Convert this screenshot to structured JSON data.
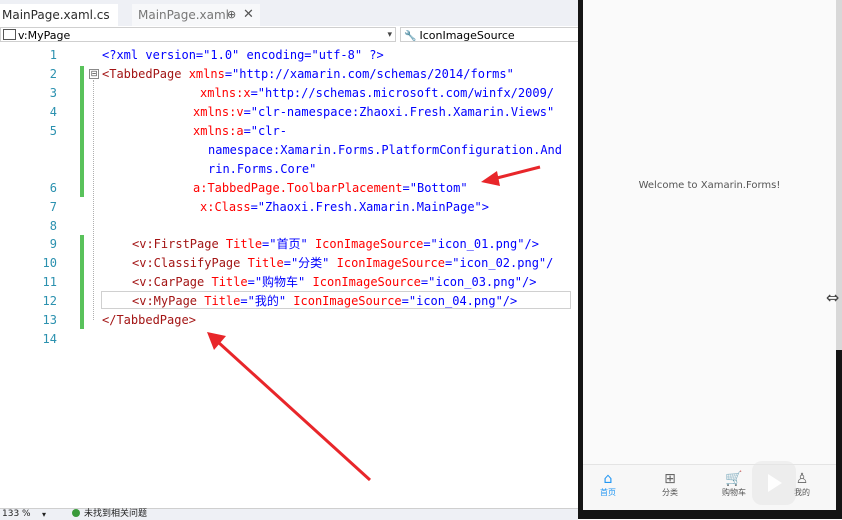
{
  "tabs": [
    {
      "label": "MainPage.xaml.cs",
      "active": true
    },
    {
      "label": "MainPage.xaml",
      "active": false,
      "pin": "⊕",
      "close": "✕"
    }
  ],
  "nav": {
    "left_label": "v:MyPage",
    "right_label": "IconImageSource"
  },
  "editor": {
    "line_numbers": [
      "1",
      "2",
      "3",
      "4",
      "5",
      "",
      "",
      "6",
      "7",
      "8",
      "9",
      "10",
      "11",
      "12",
      "13",
      "14"
    ],
    "collapse_glyph": "⊟"
  },
  "code": {
    "l1": "<?xml version=\"1.0\" encoding=\"utf-8\" ?>",
    "l2a": "<TabbedPage ",
    "l2b": "xmlns",
    "l2c": "=\"http://xamarin.com/schemas/2014/forms\"",
    "l3a": "xmlns:x",
    "l3b": "=\"http://schemas.microsoft.com/winfx/2009/",
    "l4a": "xmlns:v",
    "l4b": "=\"clr-namespace:Zhaoxi.Fresh.Xamarin.Views\"",
    "l5a": "xmlns:a",
    "l5b": "=\"clr-",
    "l5c": "namespace:Xamarin.Forms.PlatformConfiguration.And",
    "l5d": "rin.Forms.Core\"",
    "l6a": "a:TabbedPage.ToolbarPlacement",
    "l6b": "=\"Bottom\"",
    "l7a": "x:Class",
    "l7b": "=\"Zhaoxi.Fresh.Xamarin.MainPage\">",
    "l9a": "<v:FirstPage ",
    "l9b": "Title",
    "l9c": "=\"首页\" ",
    "l9d": "IconImageSource",
    "l9e": "=\"icon_01.png\"/>",
    "l10a": "<v:ClassifyPage ",
    "l10b": "Title",
    "l10c": "=\"分类\" ",
    "l10d": "IconImageSource",
    "l10e": "=\"icon_02.png\"/",
    "l11a": "<v:CarPage ",
    "l11b": "Title",
    "l11c": "=\"购物车\" ",
    "l11d": "IconImageSource",
    "l11e": "=\"icon_03.png\"/>",
    "l12a": "<v:MyPage ",
    "l12b": "Title",
    "l12c": "=\"我的\" ",
    "l12d": "IconImageSource",
    "l12e": "=\"icon_04.png\"/>",
    "l13": "</TabbedPage>"
  },
  "status": {
    "zoom": "133 %",
    "issues": "未找到相关问题"
  },
  "phone": {
    "welcome": "Welcome to Xamarin.Forms!",
    "tabs": [
      {
        "label": "首页",
        "icon": "home-icon",
        "selected": true
      },
      {
        "label": "分类",
        "icon": "category-icon",
        "selected": false
      },
      {
        "label": "购物车",
        "icon": "cart-icon",
        "selected": false
      },
      {
        "label": "我的",
        "icon": "user-icon",
        "selected": false
      }
    ]
  },
  "colors": {
    "keyword_blue": "#0000ff",
    "element_brown": "#a31515",
    "attribute_red": "#ff0000",
    "line_number": "#2b91af",
    "change_green": "#59c25b",
    "annotation_red": "#e8262a",
    "tab_selected": "#2196f3"
  }
}
